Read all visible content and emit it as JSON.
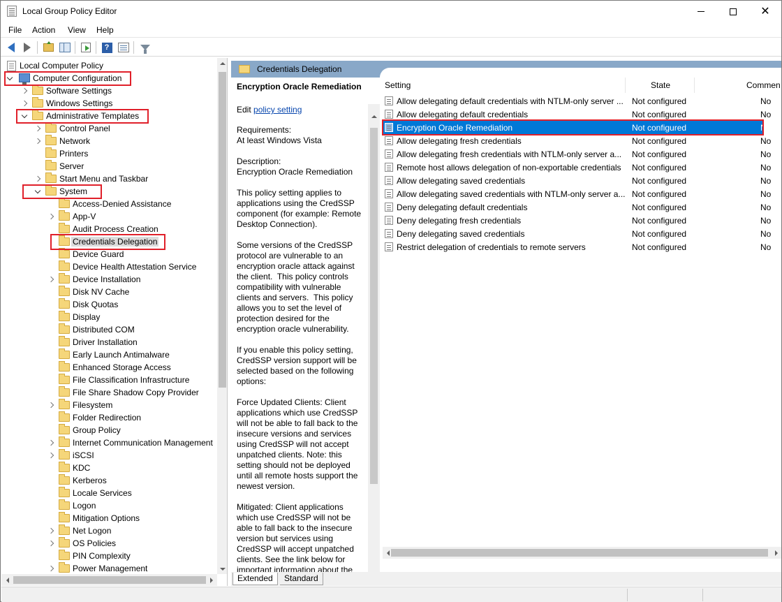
{
  "window": {
    "title": "Local Group Policy Editor"
  },
  "menu": {
    "file": "File",
    "action": "Action",
    "view": "View",
    "help": "Help"
  },
  "tree": {
    "root": "Local Computer Policy",
    "computer_config": "Computer Configuration",
    "software_settings": "Software Settings",
    "windows_settings": "Windows Settings",
    "admin_templates": "Administrative Templates",
    "control_panel": "Control Panel",
    "network": "Network",
    "printers": "Printers",
    "server": "Server",
    "start_menu": "Start Menu and Taskbar",
    "system": "System",
    "system_children": [
      "Access-Denied Assistance",
      "App-V",
      "Audit Process Creation",
      "Credentials Delegation",
      "Device Guard",
      "Device Health Attestation Service",
      "Device Installation",
      "Disk NV Cache",
      "Disk Quotas",
      "Display",
      "Distributed COM",
      "Driver Installation",
      "Early Launch Antimalware",
      "Enhanced Storage Access",
      "File Classification Infrastructure",
      "File Share Shadow Copy Provider",
      "Filesystem",
      "Folder Redirection",
      "Group Policy",
      "Internet Communication Management",
      "iSCSI",
      "KDC",
      "Kerberos",
      "Locale Services",
      "Logon",
      "Mitigation Options",
      "Net Logon",
      "OS Policies",
      "PIN Complexity",
      "Power Management"
    ]
  },
  "panel": {
    "header": "Credentials Delegation",
    "desc_title": "Encryption Oracle Remediation",
    "edit_prefix": "Edit ",
    "edit_link": "policy setting",
    "description": "Requirements:\nAt least Windows Vista\n\nDescription:\nEncryption Oracle Remediation\n\nThis policy setting applies to applications using the CredSSP component (for example: Remote Desktop Connection).\n\nSome versions of the CredSSP protocol are vulnerable to an encryption oracle attack against the client.  This policy controls compatibility with vulnerable clients and servers.  This policy allows you to set the level of protection desired for the encryption oracle vulnerability.\n\nIf you enable this policy setting, CredSSP version support will be selected based on the following options:\n\nForce Updated Clients: Client applications which use CredSSP will not be able to fall back to the insecure versions and services using CredSSP will not accept unpatched clients. Note: this setting should not be deployed until all remote hosts support the newest version.\n\nMitigated: Client applications which use CredSSP will not be able to fall back to the insecure version but services using CredSSP will accept unpatched clients. See the link below for important information about the risk posed"
  },
  "columns": {
    "setting": "Setting",
    "state": "State",
    "comment": "Commen"
  },
  "settings": [
    {
      "name": "Allow delegating default credentials with NTLM-only server ...",
      "state": "Not configured",
      "comment": "No"
    },
    {
      "name": "Allow delegating default credentials",
      "state": "Not configured",
      "comment": "No"
    },
    {
      "name": "Encryption Oracle Remediation",
      "state": "Not configured",
      "comment": "No"
    },
    {
      "name": "Allow delegating fresh credentials",
      "state": "Not configured",
      "comment": "No"
    },
    {
      "name": "Allow delegating fresh credentials with NTLM-only server a...",
      "state": "Not configured",
      "comment": "No"
    },
    {
      "name": "Remote host allows delegation of non-exportable credentials",
      "state": "Not configured",
      "comment": "No"
    },
    {
      "name": "Allow delegating saved credentials",
      "state": "Not configured",
      "comment": "No"
    },
    {
      "name": "Allow delegating saved credentials with NTLM-only server a...",
      "state": "Not configured",
      "comment": "No"
    },
    {
      "name": "Deny delegating default credentials",
      "state": "Not configured",
      "comment": "No"
    },
    {
      "name": "Deny delegating fresh credentials",
      "state": "Not configured",
      "comment": "No"
    },
    {
      "name": "Deny delegating saved credentials",
      "state": "Not configured",
      "comment": "No"
    },
    {
      "name": "Restrict delegation of credentials to remote servers",
      "state": "Not configured",
      "comment": "No"
    }
  ],
  "tabs": {
    "extended": "Extended",
    "standard": "Standard"
  },
  "colors": {
    "selection": "#0078d7",
    "highlight_box": "#e0202a",
    "panel_header": "#89a8c8"
  }
}
